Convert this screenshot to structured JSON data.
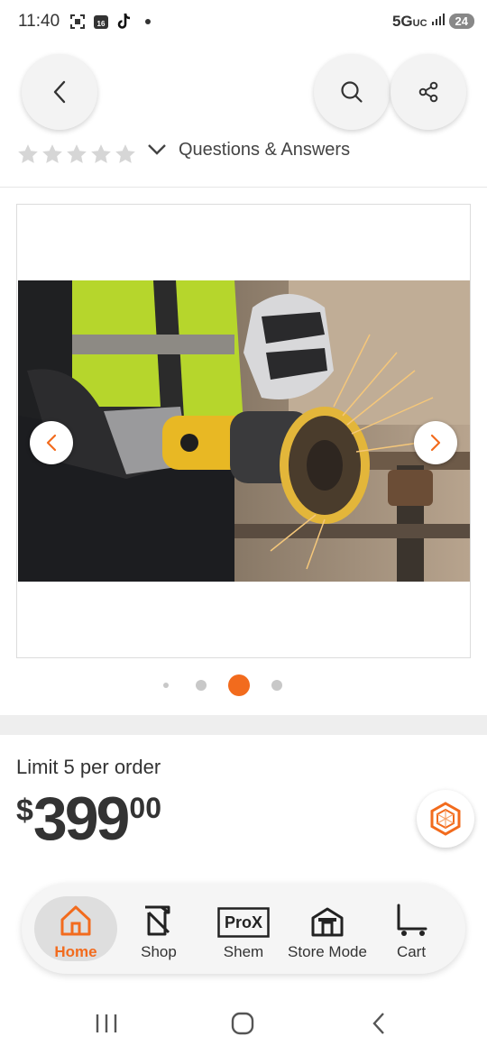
{
  "status_bar": {
    "time": "11:40",
    "network": "5G",
    "network_sub": "UC",
    "battery": "24",
    "notification_icons": [
      "screenshot-icon",
      "calendar-icon",
      "tiktok-icon",
      "dot-icon"
    ]
  },
  "header": {
    "back_icon": "chevron-left-icon",
    "search_icon": "search-icon",
    "share_icon": "share-icon"
  },
  "rating": {
    "stars": 5,
    "questions_link": "Questions & Answers"
  },
  "carousel": {
    "image_subject": "angle-grinder-in-use",
    "dots": 4,
    "active_index": 2
  },
  "pricing": {
    "limit_text": "Limit 5 per order",
    "currency": "$",
    "dollars": "399",
    "cents": "00"
  },
  "bottom_nav": {
    "items": [
      {
        "label": "Home",
        "icon": "home-icon",
        "active": true
      },
      {
        "label": "Shop",
        "icon": "shop-icon",
        "active": false
      },
      {
        "label": "Shem",
        "icon": "prox-icon",
        "active": false
      },
      {
        "label": "Store Mode",
        "icon": "store-icon",
        "active": false
      },
      {
        "label": "Cart",
        "icon": "cart-icon",
        "active": false
      }
    ],
    "prox_badge": "ProX"
  },
  "colors": {
    "accent": "#f26b1d",
    "text": "#333333",
    "star_empty": "#d6d6d6"
  }
}
